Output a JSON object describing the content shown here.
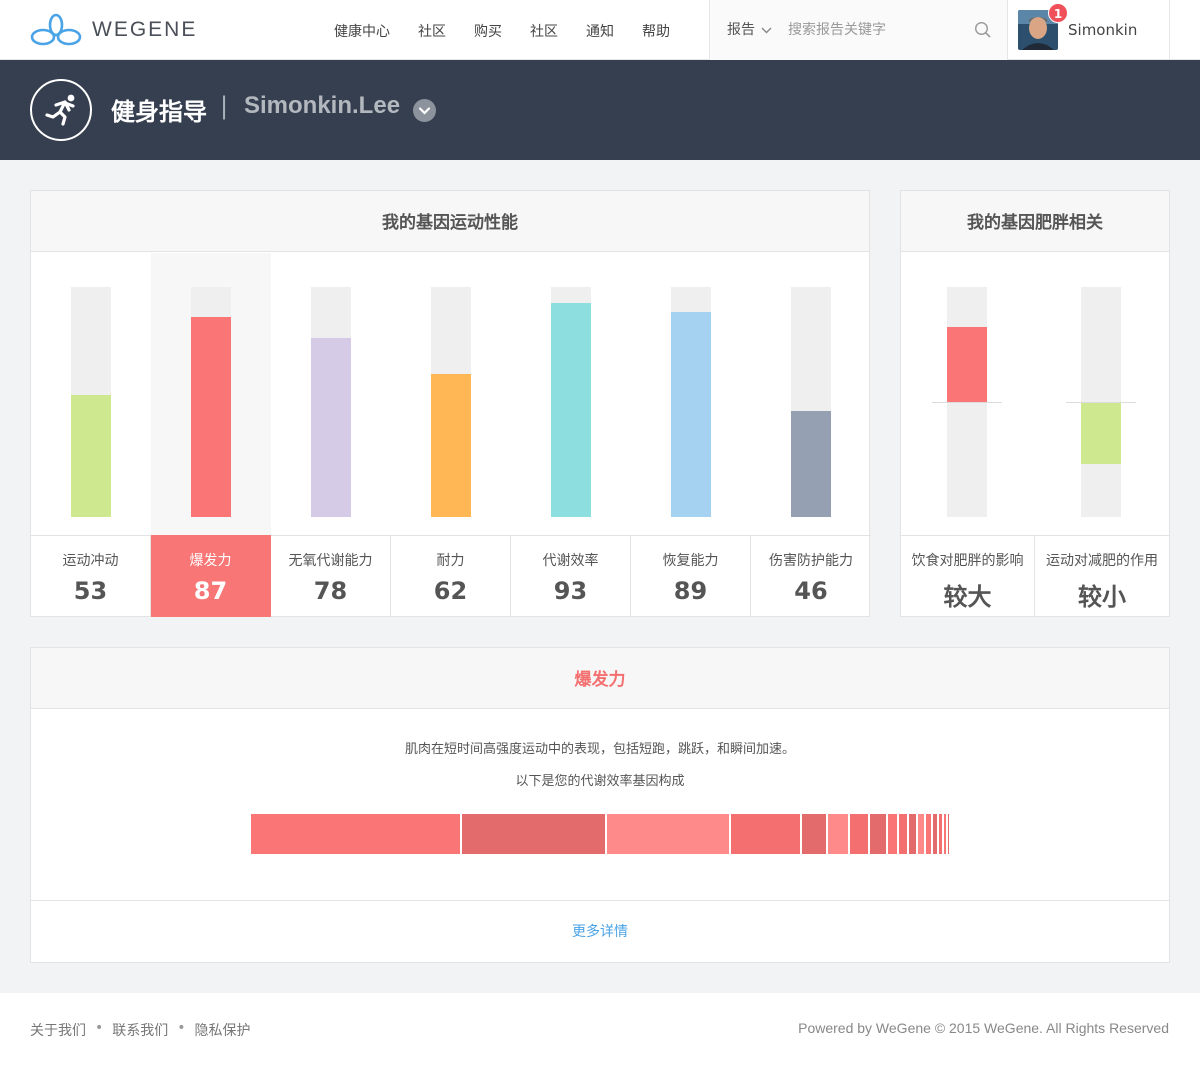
{
  "brand": {
    "name": "WEGENE"
  },
  "nav": {
    "items": [
      {
        "label": "健康中心"
      },
      {
        "label": "社区"
      },
      {
        "label": "购买"
      },
      {
        "label": "社区"
      },
      {
        "label": "通知"
      },
      {
        "label": "帮助"
      }
    ]
  },
  "search": {
    "scope": "报告",
    "placeholder": "搜索报告关键字"
  },
  "user": {
    "name": "Simonkin",
    "notifications": "1"
  },
  "banner": {
    "title": "健身指导",
    "separator": "|",
    "profile": "Simonkin.Lee"
  },
  "performance": {
    "title": "我的基因运动性能",
    "items": [
      {
        "label": "运动冲动",
        "score": "53",
        "value": 53,
        "color": "#cde88e",
        "active": false
      },
      {
        "label": "爆发力",
        "score": "87",
        "value": 87,
        "color": "#fa7676",
        "active": true
      },
      {
        "label": "无氧代谢能力",
        "score": "78",
        "value": 78,
        "color": "#d5cbe7",
        "active": false
      },
      {
        "label": "耐力",
        "score": "62",
        "value": 62,
        "color": "#ffb755",
        "active": false
      },
      {
        "label": "代谢效率",
        "score": "93",
        "value": 93,
        "color": "#8ddedf",
        "active": false
      },
      {
        "label": "恢复能力",
        "score": "89",
        "value": 89,
        "color": "#a6d2f1",
        "active": false
      },
      {
        "label": "伤害防护能力",
        "score": "46",
        "value": 46,
        "color": "#96a0b3",
        "active": false
      }
    ]
  },
  "obesity": {
    "title": "我的基因肥胖相关",
    "items": [
      {
        "label": "饮食对肥胖的影响",
        "result": "较大",
        "value": 0.65,
        "color": "#fa7676"
      },
      {
        "label": "运动对减肥的作用",
        "result": "较小",
        "value": -0.54,
        "color": "#cde88e"
      }
    ]
  },
  "detail": {
    "title": "爆发力",
    "description": "肌肉在短时间高强度运动中的表现，包括短跑，跳跃，和瞬间加速。",
    "subtitle": "以下是您的代谢效率基因构成",
    "segments": [
      {
        "share": 213,
        "color": "#fa7676"
      },
      {
        "share": 147,
        "color": "#e36b6b"
      },
      {
        "share": 126,
        "color": "#ff8a8a"
      },
      {
        "share": 71,
        "color": "#f46f6f"
      },
      {
        "share": 27,
        "color": "#e36b6b"
      },
      {
        "share": 22,
        "color": "#ff8a8a"
      },
      {
        "share": 20,
        "color": "#f46f6f"
      },
      {
        "share": 18,
        "color": "#e36b6b"
      },
      {
        "share": 11,
        "color": "#fa7676"
      },
      {
        "share": 11,
        "color": "#f46f6f"
      },
      {
        "share": 9,
        "color": "#e36b6b"
      },
      {
        "share": 8,
        "color": "#ff8a8a"
      },
      {
        "share": 7,
        "color": "#fa7676"
      },
      {
        "share": 6,
        "color": "#e36b6b"
      },
      {
        "share": 5,
        "color": "#f46f6f"
      },
      {
        "share": 4,
        "color": "#fa7676"
      },
      {
        "share": 3,
        "color": "#e36b6b"
      }
    ],
    "more_link": "更多详情"
  },
  "footer": {
    "links": [
      "关于我们",
      "联系我们",
      "隐私保护"
    ],
    "separator": "•",
    "copyright": "Powered by WeGene © 2015 WeGene. All Rights Reserved"
  }
}
